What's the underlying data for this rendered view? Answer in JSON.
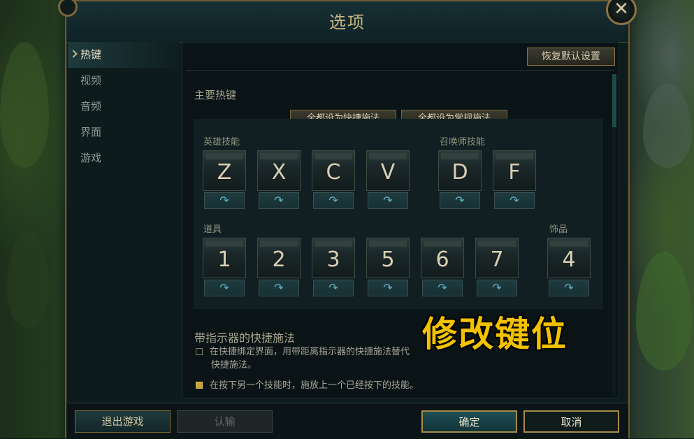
{
  "window": {
    "title": "选项"
  },
  "close_glyph": "✕",
  "sidebar": {
    "items": [
      {
        "label": "热键",
        "active": true
      },
      {
        "label": "视频"
      },
      {
        "label": "音频"
      },
      {
        "label": "界面"
      },
      {
        "label": "游戏"
      }
    ]
  },
  "panel": {
    "reset_label": "恢复默认设置",
    "main_hotkeys_title": "主要热键",
    "set_all_quick_label": "全都设为快捷施法",
    "set_all_normal_label": "全都设为常规施法",
    "champion_abilities_label": "英雄技能",
    "summoner_spells_label": "召唤师技能",
    "items_label": "道具",
    "trinket_label": "饰品",
    "champion_keys": [
      "Z",
      "X",
      "C",
      "V"
    ],
    "summoner_keys": [
      "D",
      "F"
    ],
    "item_keys": [
      "1",
      "2",
      "3",
      "5",
      "6",
      "7"
    ],
    "trinket_key": "4",
    "arrow_glyph": "↷",
    "quickcast_indicator_title": "带指示器的快捷施法",
    "option1_line1": "在快捷绑定界面，用带距离指示器的快捷施法替代",
    "option1_line2": "快捷施法。",
    "option1_checked": false,
    "option2_text": "在按下另一个技能时，施放上一个已经按下的技能。",
    "option2_checked": true
  },
  "overlay_text": "修改键位",
  "footer": {
    "exit_label": "退出游戏",
    "surrender_label": "认输",
    "ok_label": "确定",
    "cancel_label": "取消"
  },
  "colors": {
    "gold": "#c9b784",
    "accent_teal": "#1e4f55",
    "overlay_yellow": "#f2c200"
  }
}
